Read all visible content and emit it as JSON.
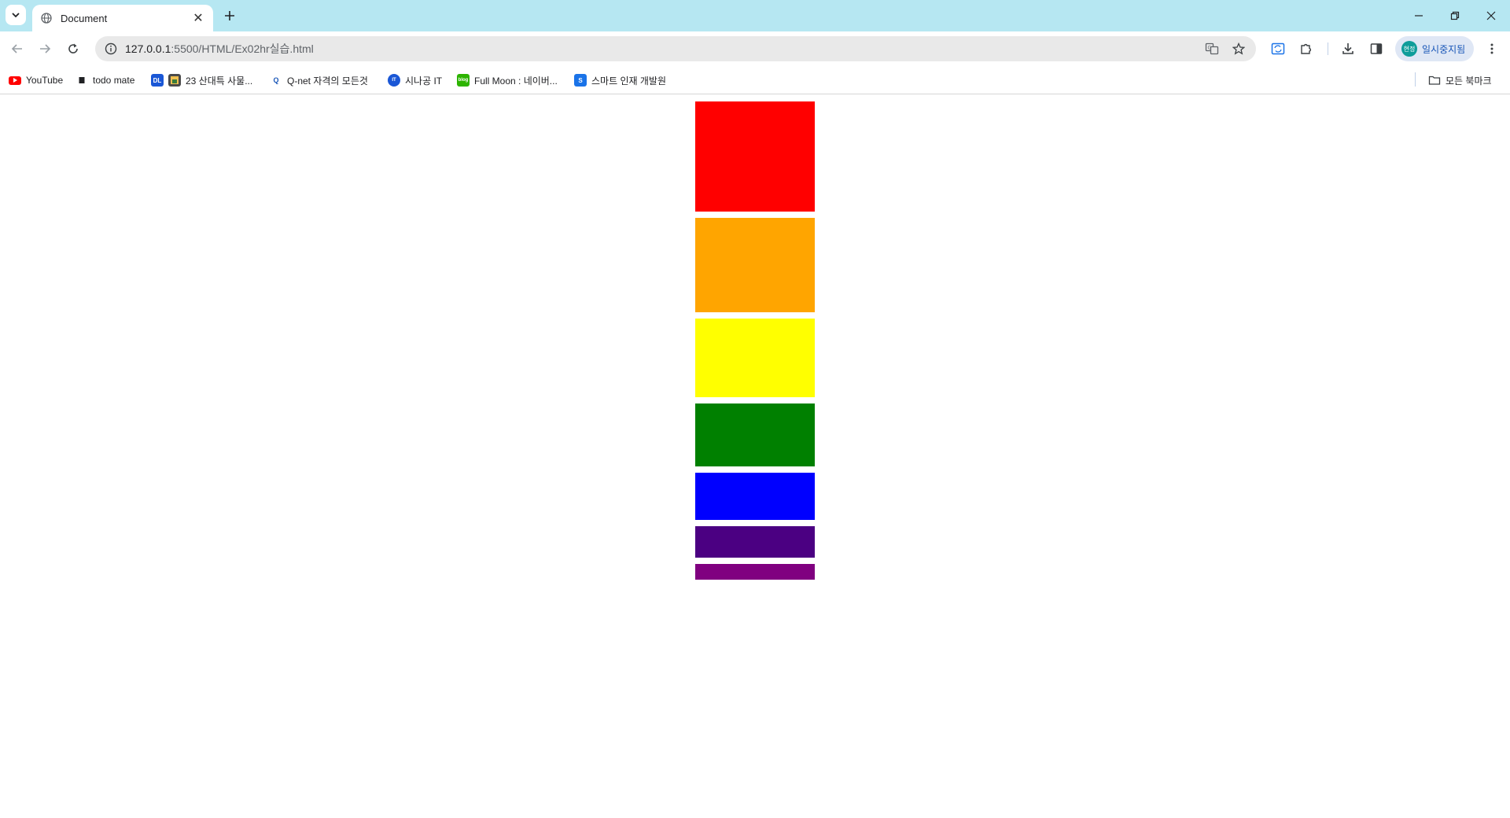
{
  "tab": {
    "title": "Document",
    "close_glyph": "✕"
  },
  "toolbar": {
    "url_host": "127.0.0.1",
    "url_path": ":5500/HTML/Ex02hr실습.html"
  },
  "profile": {
    "avatar_text": "현정",
    "label": "일시중지됨"
  },
  "bookmarks": [
    {
      "label": "YouTube",
      "icon": "youtube-icon"
    },
    {
      "label": "todo mate",
      "icon": "todo-icon"
    },
    {
      "label": "",
      "icon": "dl-icon"
    },
    {
      "label": "23 산대특 사물...",
      "icon": "folder-image-icon"
    },
    {
      "label": "Q-net 자격의 모든것",
      "icon": "qnet-icon"
    },
    {
      "label": "시나공 IT",
      "icon": "sinagong-icon"
    },
    {
      "label": "Full Moon : 네이버...",
      "icon": "naver-blog-icon"
    },
    {
      "label": "스마트 인재 개발원",
      "icon": "smart-icon"
    }
  ],
  "all_bookmarks_label": "모든 북마크",
  "rainbow": {
    "colors": [
      "#ff0000",
      "#ffa500",
      "#ffff00",
      "#008000",
      "#0000ff",
      "#4b0082",
      "#800080"
    ]
  }
}
